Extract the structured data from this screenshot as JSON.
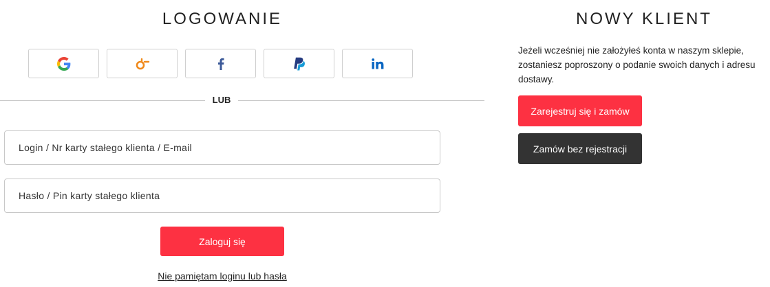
{
  "login": {
    "title": "LOGOWANIE",
    "social": [
      {
        "icon": "google-icon"
      },
      {
        "icon": "odnoklassniki-icon"
      },
      {
        "icon": "facebook-icon"
      },
      {
        "icon": "paypal-icon"
      },
      {
        "icon": "linkedin-icon"
      }
    ],
    "divider_text": "LUB",
    "login_placeholder": "Login / Nr karty stałego klienta / E-mail",
    "login_value": "",
    "password_placeholder": "Hasło / Pin karty stałego klienta",
    "password_value": "",
    "submit_label": "Zaloguj się",
    "forgot_label": "Nie pamiętam loginu lub hasła"
  },
  "new_customer": {
    "title": "NOWY KLIENT",
    "description_lines": [
      "Jeżeli wcześniej nie założyłeś konta w naszym sklepie,",
      "zostaniesz poproszony o podanie swoich danych i adresu",
      "dostawy."
    ],
    "register_label": "Zarejestruj się i zamów",
    "guest_label": "Zamów bez rejestracji"
  },
  "colors": {
    "accent": "#fd3142",
    "dark_button": "#333333",
    "border": "#c8c8c8"
  }
}
